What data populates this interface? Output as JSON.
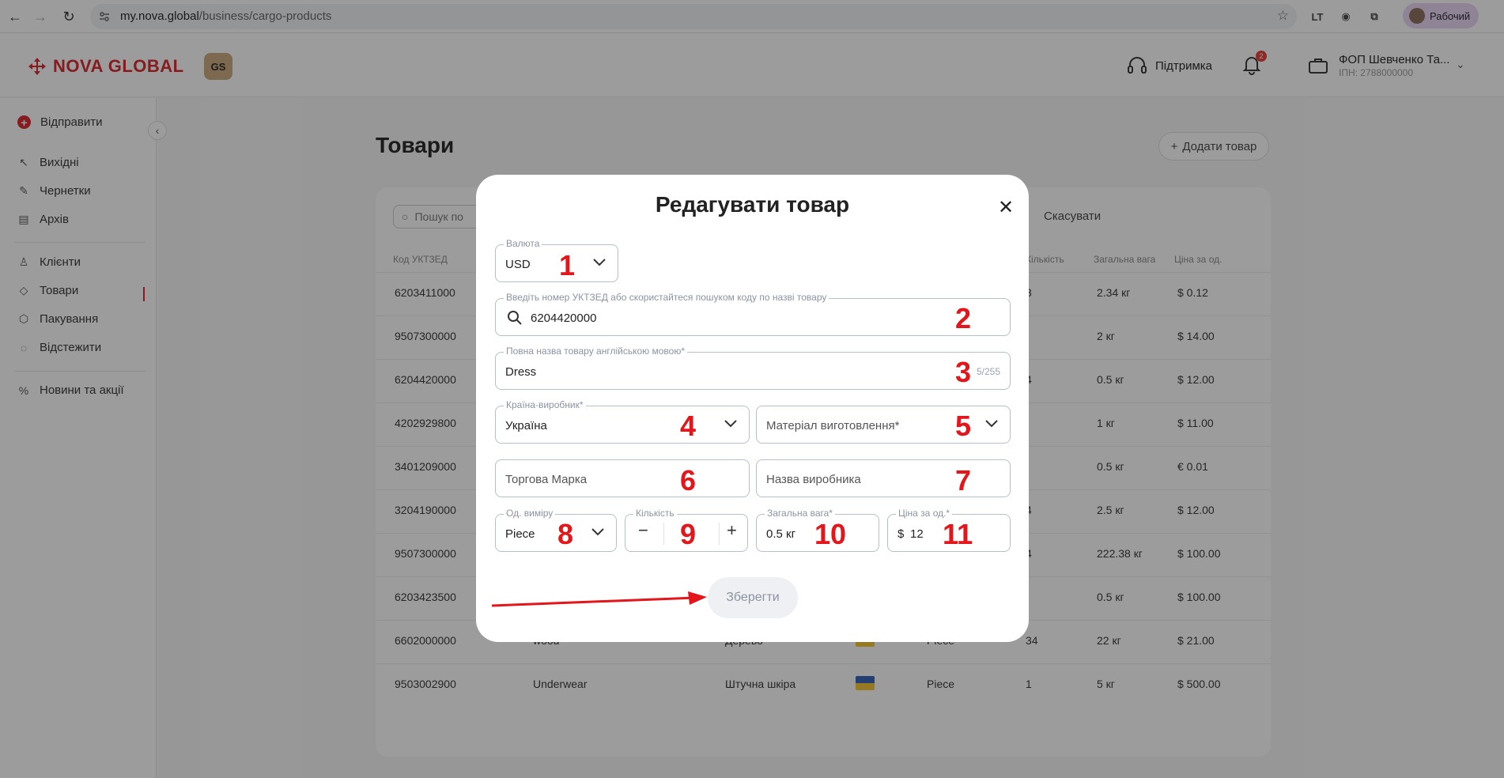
{
  "browser": {
    "url_host": "my.nova.global",
    "url_path": "/business/cargo-products",
    "profile_label": "Рабочий",
    "ext_label": "LT"
  },
  "header": {
    "logo_text": "NOVA GLOBAL",
    "gs_badge": "GS",
    "support_label": "Підтримка",
    "notif_count": "2",
    "account_name": "ФОП Шевченко Та...",
    "account_tax": "ІПН: 2788000000"
  },
  "sidebar": {
    "send": "Відправити",
    "outgoing": "Вихідні",
    "drafts": "Чернетки",
    "archive": "Архів",
    "clients": "Клієнти",
    "products": "Товари",
    "packaging": "Пакування",
    "tracking": "Відстежити",
    "news": "Новини та акції"
  },
  "page": {
    "title": "Товари",
    "add_button": "Додати товар",
    "search_placeholder": "Пошук по",
    "cancel": "Скасувати",
    "columns": {
      "code": "Код УКТЗЕД",
      "qty": "Кількість",
      "weight": "Загальна вага",
      "price": "Ціна за од."
    },
    "rows": [
      {
        "code": "6203411000",
        "name": "",
        "material": "",
        "unit": "",
        "qty": "3",
        "weight": "2.34 кг",
        "price": "$ 0.12"
      },
      {
        "code": "9507300000",
        "name": "",
        "material": "",
        "unit": "",
        "qty": "",
        "weight": "2 кг",
        "price": "$ 14.00"
      },
      {
        "code": "6204420000",
        "name": "",
        "material": "",
        "unit": "",
        "qty": "4",
        "weight": "0.5 кг",
        "price": "$ 12.00"
      },
      {
        "code": "4202929800",
        "name": "",
        "material": "",
        "unit": "",
        "qty": "",
        "weight": "1 кг",
        "price": "$ 11.00"
      },
      {
        "code": "3401209000",
        "name": "",
        "material": "",
        "unit": "",
        "qty": "",
        "weight": "0.5 кг",
        "price": "€ 0.01"
      },
      {
        "code": "3204190000",
        "name": "",
        "material": "",
        "unit": "",
        "qty": "4",
        "weight": "2.5 кг",
        "price": "$ 12.00"
      },
      {
        "code": "9507300000",
        "name": "",
        "material": "",
        "unit": "",
        "qty": "4",
        "weight": "222.38 кг",
        "price": "$ 100.00"
      },
      {
        "code": "6203423500",
        "name": "",
        "material": "",
        "unit": "",
        "qty": "",
        "weight": "0.5 кг",
        "price": "$ 100.00"
      },
      {
        "code": "6602000000",
        "name": "wood",
        "material": "Дерево",
        "unit": "Piece",
        "qty": "34",
        "weight": "22 кг",
        "price": "$ 21.00"
      },
      {
        "code": "9503002900",
        "name": "Underwear",
        "material": "Штучна шкіра",
        "unit": "Piece",
        "qty": "1",
        "weight": "5 кг",
        "price": "$ 500.00"
      }
    ]
  },
  "modal": {
    "title": "Редагувати товар",
    "currency": {
      "label": "Валюта",
      "value": "USD"
    },
    "code": {
      "label": "Введіть номер УКТЗЕД або скористайтеся пошуком коду по назві товару",
      "value": "6204420000"
    },
    "name_en": {
      "label": "Повна назва товару англійською мовою*",
      "value": "Dress",
      "counter": "5/255"
    },
    "country": {
      "label": "Країна-виробник*",
      "value": "Україна"
    },
    "material": {
      "placeholder": "Матеріал виготовлення*"
    },
    "brand": {
      "placeholder": "Торгова Марка"
    },
    "manufacturer": {
      "placeholder": "Назва виробника"
    },
    "unit": {
      "label": "Од. виміру",
      "value": "Piece"
    },
    "quantity": {
      "label": "Кількість"
    },
    "weight": {
      "label": "Загальна вага*",
      "value": "0.5 кг"
    },
    "price": {
      "label": "Ціна за од.*",
      "prefix": "$",
      "value": "12"
    },
    "save": "Зберегти"
  },
  "annotations": [
    "1",
    "2",
    "3",
    "4",
    "5",
    "6",
    "7",
    "8",
    "9",
    "10",
    "11"
  ],
  "colors": {
    "brand": "#d8232a",
    "annotation": "#e3161b"
  }
}
